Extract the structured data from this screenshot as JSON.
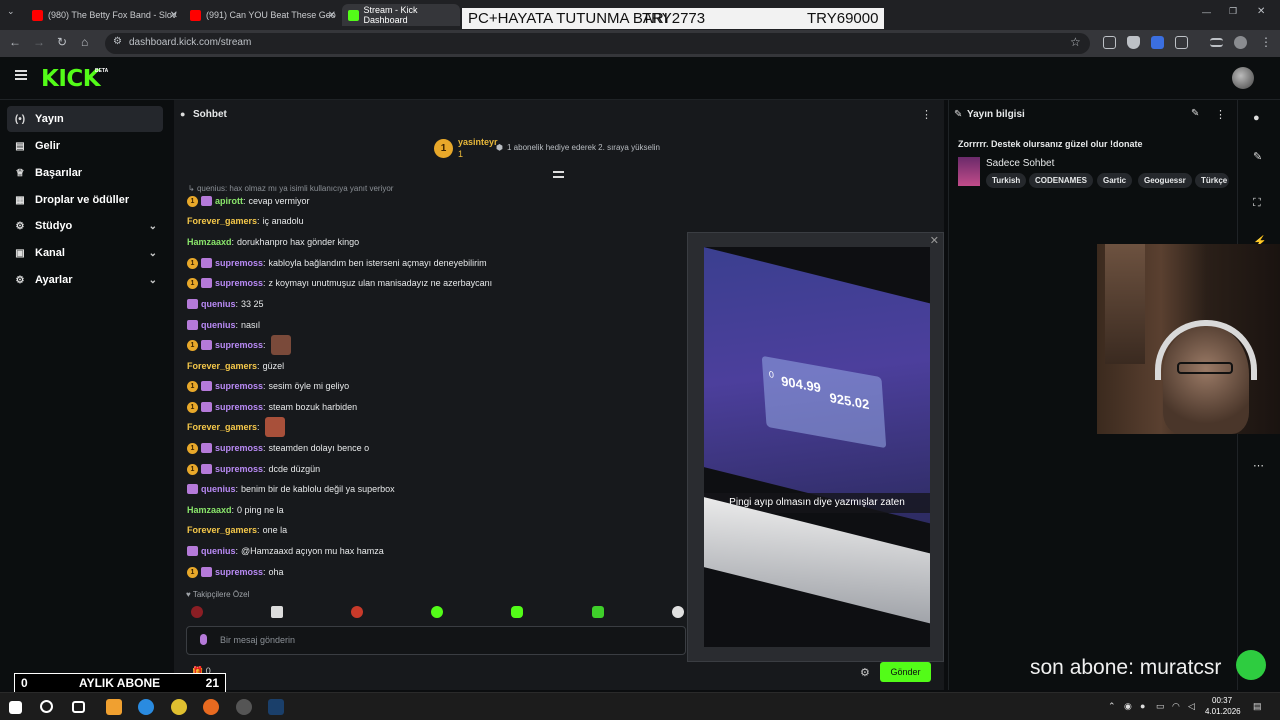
{
  "browser": {
    "tabs": [
      {
        "label": "(980) The Betty Fox Band - Slov",
        "icon": "youtube-icon"
      },
      {
        "label": "(991) Can YOU Beat These Geo",
        "icon": "youtube-icon"
      },
      {
        "label": "Stream - Kick Dashboard",
        "icon": "kick-icon"
      }
    ],
    "url": "dashboard.kick.com/stream"
  },
  "banner": {
    "left": "PC+HAYATA TUTUNMA BARI",
    "mid": "TRY2773",
    "right": "TRY69000"
  },
  "header": {
    "logo": "KICK",
    "beta": "BETA"
  },
  "sidebar": {
    "items": [
      {
        "label": "Yayın",
        "icon": "broadcast-icon"
      },
      {
        "label": "Gelir",
        "icon": "revenue-icon"
      },
      {
        "label": "Başarılar",
        "icon": "trophy-icon"
      },
      {
        "label": "Droplar ve ödüller",
        "icon": "drops-icon"
      },
      {
        "label": "Stüdyo",
        "icon": "studio-icon"
      },
      {
        "label": "Kanal",
        "icon": "channel-icon"
      },
      {
        "label": "Ayarlar",
        "icon": "settings-icon"
      }
    ]
  },
  "chat": {
    "title": "Sohbet",
    "pinned": {
      "badge": "1",
      "user": "yasinteyr",
      "count": "1",
      "message": "1 abonelik hediye ederek 2. sıraya yükselin"
    },
    "reply": "quenius: hax olmaz mı ya isimli kullanıcıya yanıt veriyor",
    "messages": [
      {
        "user": "apirott",
        "text": "cevap vermiyor",
        "color": "u-green",
        "badges": true
      },
      {
        "user": "Forever_gamers",
        "text": "iç anadolu",
        "color": "u-orange",
        "badges": false
      },
      {
        "user": "Hamzaaxd",
        "text": "dorukhanpro hax gönder kingo",
        "color": "u-green",
        "badges": false
      },
      {
        "user": "supremoss",
        "text": "kabloyla bağlandım ben isterseni açmayı deneyebilirim",
        "color": "u-purple",
        "badges": true
      },
      {
        "user": "supremoss",
        "text": "z koymayı unutmuşuz ulan manisadayız ne azerbaycanı",
        "color": "u-purple",
        "badges": true
      },
      {
        "user": "quenius",
        "text": "33 25",
        "color": "u-purple",
        "badges": false,
        "sub": true
      },
      {
        "user": "quenius",
        "text": "nasıl",
        "color": "u-purple",
        "badges": false,
        "sub": true
      },
      {
        "user": "supremoss",
        "text": "",
        "color": "u-purple",
        "badges": true,
        "emote": "#7a4a3a"
      },
      {
        "user": "Forever_gamers",
        "text": "güzel",
        "color": "u-orange",
        "badges": false
      },
      {
        "user": "supremoss",
        "text": "sesim öyle mi geliyo",
        "color": "u-purple",
        "badges": true
      },
      {
        "user": "supremoss",
        "text": "steam bozuk harbiden",
        "color": "u-purple",
        "badges": true
      },
      {
        "user": "Forever_gamers",
        "text": "",
        "color": "u-orange",
        "badges": false,
        "emote": "#a8503a"
      },
      {
        "user": "supremoss",
        "text": "steamden dolayı bence o",
        "color": "u-purple",
        "badges": true
      },
      {
        "user": "supremoss",
        "text": "dcde düzgün",
        "color": "u-purple",
        "badges": true
      },
      {
        "user": "quenius",
        "text": "benim bir de kablolu değil ya superbox",
        "color": "u-purple",
        "badges": false,
        "sub": true
      },
      {
        "user": "Hamzaaxd",
        "text": "0 ping ne la",
        "color": "u-green",
        "badges": false
      },
      {
        "user": "Forever_gamers",
        "text": "one la",
        "color": "u-orange",
        "badges": false
      },
      {
        "user": "quenius",
        "text": "@Hamzaaxd açıyon mu hax hamza",
        "color": "u-purple",
        "badges": false,
        "sub": true
      },
      {
        "user": "supremoss",
        "text": "oha",
        "color": "u-purple",
        "badges": true
      }
    ],
    "followers_label": "Takipçilere Özel",
    "input_placeholder": "Bir mesaj gönderin",
    "send_label": "Gönder",
    "gift_count": "0"
  },
  "popup": {
    "caption": "Pingi ayıp olmasın diye yazmışlar zaten",
    "speed_down": "904.99",
    "speed_up": "925.02",
    "ping": "0"
  },
  "stream_info": {
    "title": "Yayın bilgisi",
    "stream_title": "Zorrrrr. Destek olursanız güzel olur !donate",
    "category": "Sadece Sohbet",
    "tags": [
      "Turkish",
      "CODENAMES",
      "Gartic",
      "Geoguessr",
      "Türkçe"
    ]
  },
  "overlays": {
    "sub_left": "0",
    "sub_mid": "AYLIK ABONE",
    "sub_right": "21",
    "last_sub": "son abone: muratcsr"
  },
  "taskbar": {
    "time": "00:37",
    "date": "4.01.2026"
  },
  "colors": {
    "kick_green": "#53fc18",
    "panel": "#17191c",
    "bg": "#0b0e0f"
  }
}
